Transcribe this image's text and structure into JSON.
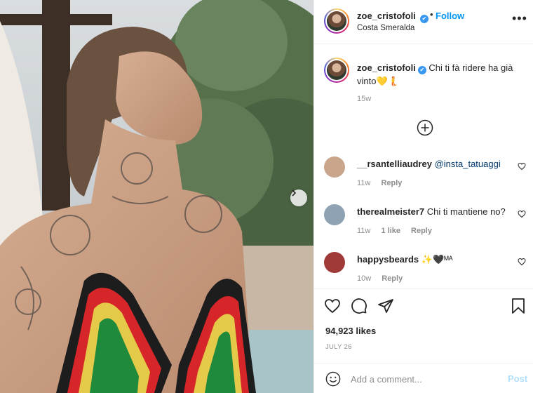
{
  "author": {
    "username": "zoe_cristofoli",
    "verified_icon": "✔",
    "follow_label": "Follow",
    "separator": "•",
    "location": "Costa Smeralda",
    "more_icon": "•••"
  },
  "caption": {
    "username": "zoe_cristofoli",
    "text": "Chi ti fà ridere ha già vinto💛🧜",
    "time": "15w"
  },
  "comments": [
    {
      "username": "__rsantelliaudrey",
      "text": "@insta_tatuaggi",
      "time": "11w",
      "likes": "",
      "reply_label": "Reply",
      "avatar_color": "#c9a58c"
    },
    {
      "username": "therealmeister7",
      "text": "Chi ti mantiene no?",
      "time": "11w",
      "likes": "1 like",
      "reply_label": "Reply",
      "avatar_color": "#8fa2b4"
    },
    {
      "username": "happysbeards",
      "text": "✨🖤ᴹᴬ",
      "time": "10w",
      "likes": "",
      "reply_label": "Reply",
      "avatar_color": "#a03a38"
    }
  ],
  "stats": {
    "likes": "94,923 likes",
    "date": "JULY 26"
  },
  "composer": {
    "placeholder": "Add a comment...",
    "post_label": "Post"
  },
  "colors": {
    "link_blue": "#0095f6",
    "muted": "#8e8e8e",
    "post_disabled": "#b2dffc"
  }
}
